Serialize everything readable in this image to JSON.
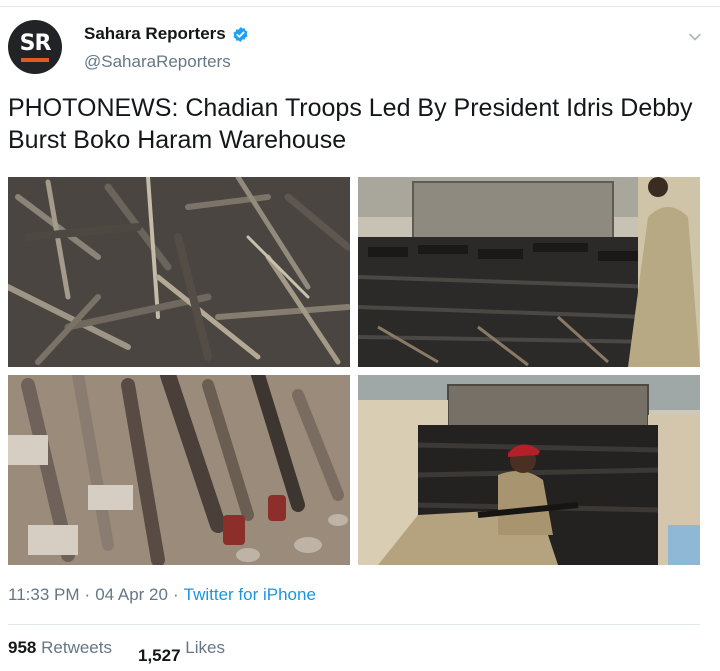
{
  "author": {
    "avatar_text": "SR",
    "display_name": "Sahara Reporters",
    "handle": "@SaharaReporters",
    "verified": true,
    "avatar_bg": "#222326",
    "avatar_accent": "#e35b1e"
  },
  "tweet": {
    "text": "PHOTONEWS: Chadian Troops Led By President Idris Debby Burst Boko Haram Warehouse",
    "photos": [
      {
        "subject": "pile of seized rifles (close-up)"
      },
      {
        "subject": "truck loaded with seized rifles, soldier standing"
      },
      {
        "subject": "rocket launchers and machine guns on floor"
      },
      {
        "subject": "soldier in red beret seated on truck of rifles"
      }
    ]
  },
  "meta": {
    "time": "11:33 PM",
    "separator": "·",
    "date": "04 Apr 20",
    "source": "Twitter for iPhone"
  },
  "stats": {
    "retweets_count": "958",
    "retweets_label": "Retweets",
    "likes_count": "1,527",
    "likes_label": "Likes"
  },
  "colors": {
    "link": "#1b95e0",
    "secondary_text": "#657786",
    "verified_badge": "#1da1f2"
  },
  "icons": [
    "verified-badge-icon",
    "chevron-down-icon"
  ]
}
